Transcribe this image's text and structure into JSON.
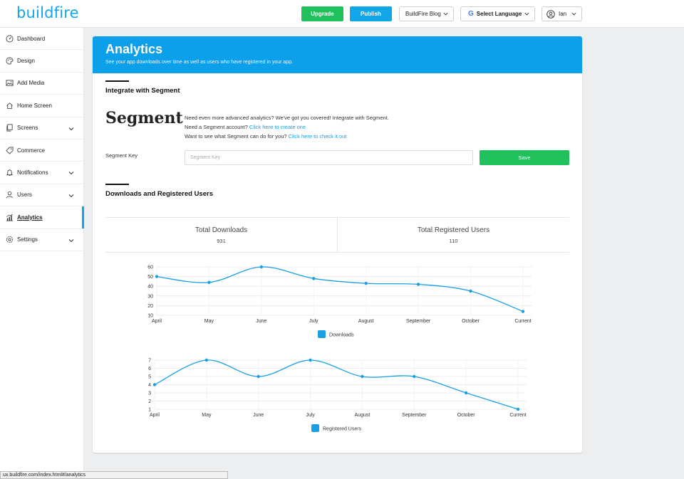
{
  "header": {
    "logo": "buildfire",
    "upgrade_label": "Upgrade",
    "publish_label": "Publish",
    "blog_label": "BuildFire Blog",
    "language_label": "Select Language",
    "user_label": "Ian"
  },
  "sidebar": {
    "items": [
      {
        "label": "Dashboard",
        "icon": "dashboard-icon"
      },
      {
        "label": "Design",
        "icon": "palette-icon"
      },
      {
        "label": "Add Media",
        "icon": "image-icon"
      },
      {
        "label": "Home Screen",
        "icon": "home-icon"
      },
      {
        "label": "Screens",
        "icon": "screens-icon"
      },
      {
        "label": "Commerce",
        "icon": "tag-icon"
      },
      {
        "label": "Notifications",
        "icon": "bell-icon"
      },
      {
        "label": "Users",
        "icon": "user-icon"
      },
      {
        "label": "Analytics",
        "icon": "analytics-icon"
      },
      {
        "label": "Settings",
        "icon": "gear-icon"
      }
    ]
  },
  "page": {
    "title": "Analytics",
    "subtitle": "See your app downloads over time as well as users who have registered in your app."
  },
  "segment": {
    "section_title": "Integrate with Segment",
    "logo_text": "Segment",
    "line1": "Need even more advanced analytics? We've got you covered! Integrate with Segment.",
    "line2_prefix": "Need a Segment account?",
    "line2_link": "Click here to create one",
    "line3_prefix": "Want to see what Segment can do for you?",
    "line3_link": "Click here to check it out",
    "key_label": "Segment Key",
    "key_placeholder": "Segment Key",
    "key_value": "",
    "save_label": "Save"
  },
  "downloads_section": {
    "title": "Downloads and Registered Users",
    "total_downloads_label": "Total Downloads",
    "total_downloads_value": "931",
    "total_registered_label": "Total Registered Users",
    "total_registered_value": "110"
  },
  "colors": {
    "brand": "#12a6e8",
    "header_blue": "#0c9fea",
    "green": "#20c05c",
    "line": "#1a9fe4"
  },
  "status_url": "ux.buildfire.com/index.html#/analytics",
  "chart_data": [
    {
      "type": "line",
      "categories": [
        "April",
        "May",
        "June",
        "July",
        "August",
        "September",
        "October",
        "Current"
      ],
      "series": [
        {
          "name": "Downloads",
          "values": [
            50,
            44,
            60,
            48,
            43,
            42,
            35,
            14
          ]
        }
      ],
      "yticks": [
        10,
        20,
        30,
        40,
        50,
        60
      ],
      "ylim": [
        10,
        60
      ],
      "legend": "bottom"
    },
    {
      "type": "line",
      "categories": [
        "April",
        "May",
        "June",
        "July",
        "August",
        "September",
        "October",
        "Current"
      ],
      "series": [
        {
          "name": "Registered Users",
          "values": [
            4,
            7,
            5,
            7,
            5,
            5,
            3,
            1
          ]
        }
      ],
      "yticks": [
        1,
        2,
        3,
        4,
        5,
        6,
        7
      ],
      "ylim": [
        1,
        7
      ],
      "legend": "bottom"
    }
  ]
}
